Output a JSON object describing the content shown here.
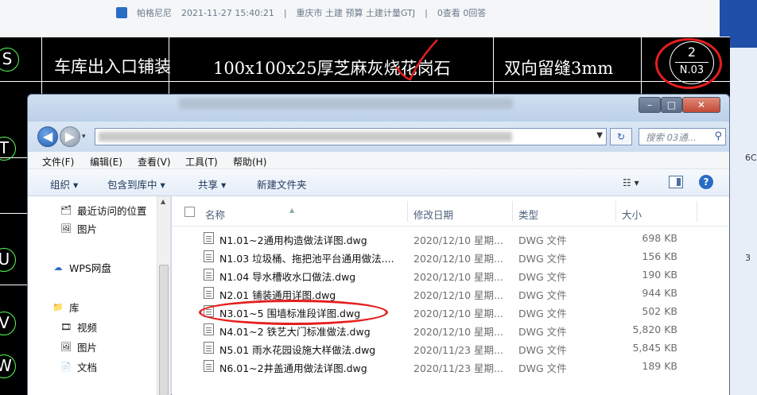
{
  "forum": {
    "author": "帕格尼尼",
    "date": "2021-11-27 15:40:21",
    "sep1": "|",
    "category": "重庆市 土建 预算 土建计量GTJ",
    "sep2": "|",
    "stats": "0查看 0回答"
  },
  "side_texts": [
    "6C",
    "3"
  ],
  "cad": {
    "row_label": "车库出入口铺装",
    "material": "100x100x25厚芝麻灰烧花岗石",
    "joint": "双向留缝3mm",
    "detail_number": "2",
    "detail_ref": "N.03",
    "axis_letters": [
      "S",
      "T",
      "U",
      "V",
      "W"
    ]
  },
  "explorer": {
    "search_placeholder": "搜索 03通...",
    "menu": [
      "文件(F)",
      "编辑(E)",
      "查看(V)",
      "工具(T)",
      "帮助(H)"
    ],
    "toolbar": {
      "organize": "组织 ▾",
      "include_library": "包含到库中 ▾",
      "share": "共享 ▾",
      "new_folder": "新建文件夹"
    },
    "nav": [
      {
        "label": "最近访问的位置",
        "icon": "recent-places-icon"
      },
      {
        "label": "图片",
        "icon": "pictures-icon"
      },
      {
        "label": "WPS网盘",
        "icon": "cloud-icon"
      },
      {
        "label": "库",
        "icon": "library-icon"
      },
      {
        "label": "视频",
        "icon": "video-icon"
      },
      {
        "label": "图片",
        "icon": "pictures-icon"
      },
      {
        "label": "文档",
        "icon": "documents-icon"
      }
    ],
    "columns": {
      "name": "名称",
      "date": "修改日期",
      "type": "类型",
      "size": "大小"
    },
    "files": [
      {
        "name": "N1.01~2通用构造做法详图.dwg",
        "date": "2020/12/10 星期...",
        "type": "DWG 文件",
        "size": "698 KB"
      },
      {
        "name": "N1.03 垃圾桶、拖把池平台通用做法....",
        "date": "2020/12/10 星期...",
        "type": "DWG 文件",
        "size": "156 KB"
      },
      {
        "name": "N1.04 导水槽收水口做法.dwg",
        "date": "2020/12/10 星期...",
        "type": "DWG 文件",
        "size": "190 KB"
      },
      {
        "name": "N2.01 铺装通用详图.dwg",
        "date": "2020/12/10 星期...",
        "type": "DWG 文件",
        "size": "944 KB"
      },
      {
        "name": "N3.01~5 围墙标准段详图.dwg",
        "date": "2020/12/10 星期...",
        "type": "DWG 文件",
        "size": "502 KB"
      },
      {
        "name": "N4.01~2 铁艺大门标准做法.dwg",
        "date": "2020/12/10 星期...",
        "type": "DWG 文件",
        "size": "5,820 KB"
      },
      {
        "name": "N5.01 雨水花园设施大样做法.dwg",
        "date": "2020/11/23 星期...",
        "type": "DWG 文件",
        "size": "5,845 KB"
      },
      {
        "name": "N6.01~2井盖通用做法详图.dwg",
        "date": "2020/11/23 星期...",
        "type": "DWG 文件",
        "size": "189 KB"
      }
    ]
  },
  "colors": {
    "annotation_red": "#e41e1e",
    "cad_background": "#000000",
    "selection_blue": "#2a6bc4"
  }
}
